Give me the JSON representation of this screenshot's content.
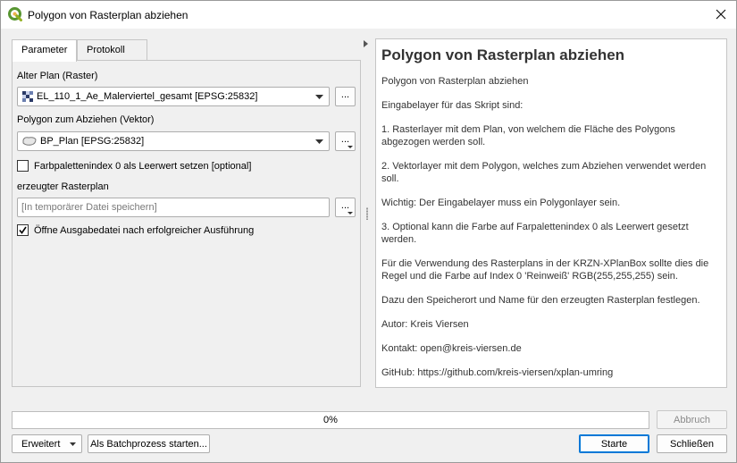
{
  "window": {
    "title": "Polygon von Rasterplan abziehen",
    "icon": "qgis-icon",
    "close_icon": "close-icon"
  },
  "tabs": [
    {
      "label": "Parameter",
      "active": true
    },
    {
      "label": "Protokoll",
      "active": false
    }
  ],
  "params": {
    "raster_label": "Alter Plan (Raster)",
    "raster_value": "EL_110_1_Ae_Malerviertel_gesamt [EPSG:25832]",
    "vector_label": "Polygon zum Abziehen (Vektor)",
    "vector_value": "BP_Plan [EPSG:25832]",
    "nodata_checkbox_label": "Farbpalettenindex 0 als Leerwert setzen [optional]",
    "nodata_checked": false,
    "output_label": "erzeugter Rasterplan",
    "output_placeholder": "[In temporärer Datei speichern]",
    "open_output_label": "Öffne Ausgabedatei nach erfolgreicher Ausführung",
    "open_output_checked": true,
    "browse_label": "..."
  },
  "help": {
    "title": "Polygon von Rasterplan abziehen",
    "paragraphs": [
      "Polygon von Rasterplan abziehen",
      "Eingabelayer für das Skript sind:",
      "1. Rasterlayer mit dem Plan, von welchem die Fläche des Polygons abgezogen werden soll.",
      "2. Vektorlayer mit dem Polygon, welches zum Abziehen verwendet werden soll.",
      "Wichtig: Der Eingabelayer muss ein Polygonlayer sein.",
      "3. Optional kann die Farbe auf Farpalettenindex 0 als Leerwert gesetzt werden.",
      "Für die Verwendung des Rasterplans in der KRZN-XPlanBox sollte dies die Regel und die Farbe auf Index 0 'Reinweiß' RGB(255,255,255) sein.",
      "Dazu den Speicherort und Name für den erzeugten Rasterplan festlegen.",
      "Autor: Kreis Viersen",
      "Kontakt: open@kreis-viersen.de",
      "GitHub: https://github.com/kreis-viersen/xplan-umring"
    ]
  },
  "progress": {
    "text": "0%",
    "value": 0
  },
  "buttons": {
    "cancel": "Abbruch",
    "advanced": "Erweitert",
    "batch": "Als Batchprozess starten...",
    "run": "Starte",
    "close": "Schließen"
  }
}
